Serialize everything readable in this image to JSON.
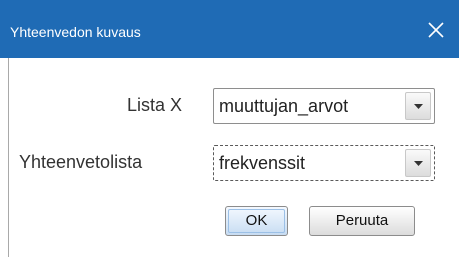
{
  "window": {
    "title": "Yhteenvedon kuvaus"
  },
  "form": {
    "lista_x": {
      "label": "Lista X",
      "value": "muuttujan_arvot"
    },
    "yhteenvetolista": {
      "label": "Yhteenvetolista",
      "value": "frekvenssit"
    }
  },
  "buttons": {
    "ok": "OK",
    "cancel": "Peruuta"
  },
  "colors": {
    "titlebar": "#1f6bb5",
    "focus": "#5a5a5a"
  }
}
